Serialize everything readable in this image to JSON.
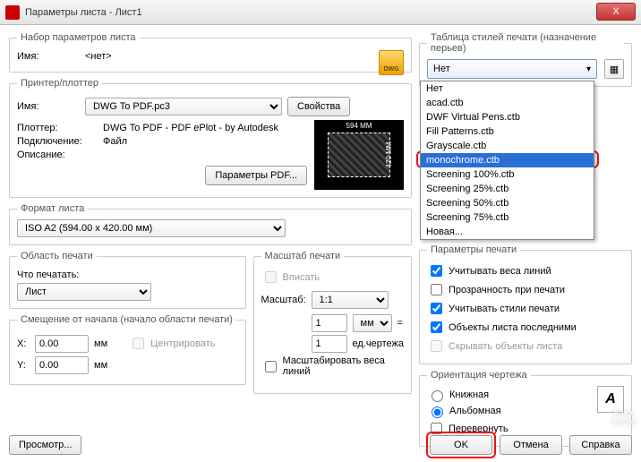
{
  "window": {
    "title": "Параметры листа - Лист1",
    "close": "X"
  },
  "pageset": {
    "legend": "Набор параметров листа",
    "name_lbl": "Имя:",
    "name_val": "<нет>",
    "dwg": "DWG"
  },
  "printer": {
    "legend": "Принтер/плоттер",
    "name_lbl": "Имя:",
    "name_val": "DWG To PDF.pc3",
    "props_btn": "Свойства",
    "plotter_lbl": "Плоттер:",
    "plotter_val": "DWG To PDF - PDF ePlot - by Autodesk",
    "conn_lbl": "Подключение:",
    "conn_val": "Файл",
    "desc_lbl": "Описание:",
    "pdf_btn": "Параметры PDF...",
    "preview_w": "594 MM",
    "preview_h": "420 MM"
  },
  "paper": {
    "legend": "Формат листа",
    "val": "ISO A2 (594.00 x 420.00 мм)"
  },
  "area": {
    "legend": "Область печати",
    "what_lbl": "Что печатать:",
    "what_val": "Лист"
  },
  "offset": {
    "legend": "Смещение от начала (начало области печати)",
    "x_lbl": "X:",
    "x_val": "0.00",
    "x_unit": "мм",
    "y_lbl": "Y:",
    "y_val": "0.00",
    "y_unit": "мм",
    "center": "Центрировать"
  },
  "scale": {
    "legend": "Масштаб печати",
    "fit": "Вписать",
    "scale_lbl": "Масштаб:",
    "scale_val": "1:1",
    "num": "1",
    "unit": "мм",
    "eq": "=",
    "den": "1",
    "den_unit": "ед.чертежа",
    "linewt": "Масштабировать веса линий"
  },
  "styles": {
    "legend": "Таблица стилей печати (назначение перьев)",
    "selected": "Нет",
    "items": [
      "Нет",
      "acad.ctb",
      "DWF Virtual Pens.ctb",
      "Fill Patterns.ctb",
      "Grayscale.ctb",
      "monochrome.ctb",
      "Screening 100%.ctb",
      "Screening 25%.ctb",
      "Screening 50%.ctb",
      "Screening 75%.ctb",
      "Новая..."
    ]
  },
  "options": {
    "legend": "Параметры печати",
    "linewt": "Учитывать веса линий",
    "trans": "Прозрачность при печати",
    "styles": "Учитывать стили печати",
    "last": "Объекты листа последними",
    "hide": "Скрывать объекты листа"
  },
  "orient": {
    "legend": "Ориентация чертежа",
    "portrait": "Книжная",
    "landscape": "Альбомная",
    "flip": "Перевернуть",
    "A": "A"
  },
  "footer": {
    "preview": "Просмотр...",
    "ok": "OK",
    "cancel": "Отмена",
    "help": "Справка"
  },
  "watermark": {
    "l1": "klub·",
    "l2": "Sovet"
  }
}
